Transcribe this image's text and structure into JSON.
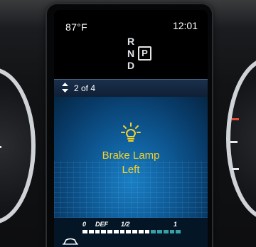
{
  "status": {
    "temperature": "87°F",
    "clock": "12:01"
  },
  "gear_selector": {
    "positions": [
      "R",
      "N",
      "D"
    ],
    "selected": "P"
  },
  "message_pager": {
    "label": "2 of 4"
  },
  "warning": {
    "icon": "bulb-warning-icon",
    "title": "Brake Lamp",
    "subtitle": "Left",
    "color": "#f5d22a"
  },
  "fuel_gauge": {
    "labels": {
      "empty": "0",
      "def": "DEF",
      "half": "1/2",
      "full": "1"
    },
    "level_fraction": 0.7,
    "fill_color": "#ffffff",
    "empty_color": "#3aa0a8"
  },
  "colors": {
    "panel_blue": "#0e5a96",
    "text_white": "#ffffff"
  }
}
